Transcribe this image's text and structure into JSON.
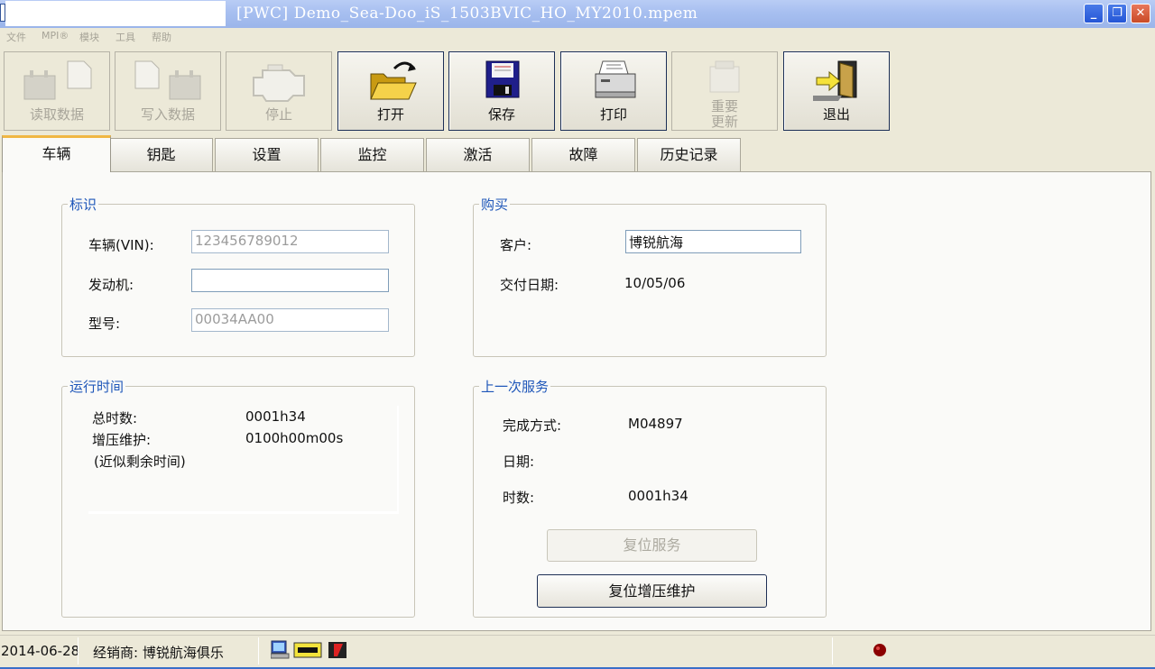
{
  "window": {
    "title": "[PWC] Demo_Sea-Doo_iS_1503BVIC_HO_MY2010.mpem",
    "minimize": "_",
    "restore": "❐",
    "close": "✕"
  },
  "menu": [
    "文件",
    "MPI®",
    "模块",
    "工具",
    "帮助"
  ],
  "toolbar": [
    {
      "label": "读取数据",
      "icon": "read-data-icon",
      "enabled": false
    },
    {
      "label": "写入数据",
      "icon": "write-data-icon",
      "enabled": false
    },
    {
      "label": "停止",
      "icon": "engine-stop-icon",
      "enabled": false
    },
    {
      "label": "打开",
      "icon": "open-folder-icon",
      "enabled": true
    },
    {
      "label": "保存",
      "icon": "floppy-disk-icon",
      "enabled": true
    },
    {
      "label": "打印",
      "icon": "printer-icon",
      "enabled": true
    },
    {
      "label_line1": "重要",
      "label_line2": "更新",
      "icon": "update-icon",
      "enabled": false
    },
    {
      "label": "退出",
      "icon": "exit-door-icon",
      "enabled": true
    }
  ],
  "tabs": [
    "车辆",
    "钥匙",
    "设置",
    "监控",
    "激活",
    "故障",
    "历史记录"
  ],
  "active_tab": "车辆",
  "identification": {
    "title": "标识",
    "vin_label": "车辆(VIN):",
    "vin_value": "123456789012",
    "engine_label": "发动机:",
    "engine_value": "",
    "model_label": "型号:",
    "model_value": "00034AA00"
  },
  "purchase": {
    "title": "购买",
    "customer_label": "客户:",
    "customer_value": "博锐航海",
    "delivery_label": "交付日期:",
    "delivery_value": "10/05/06"
  },
  "runtime": {
    "title": "运行时间",
    "total_hours_label": "总时数:",
    "total_hours_value": "0001h34",
    "supercharger_label": "增压维护:",
    "supercharger_value": "0100h00m00s",
    "approx_label": "(近似剩余时间)"
  },
  "last_service": {
    "title": "上一次服务",
    "done_by_label": "完成方式:",
    "done_by_value": "M04897",
    "date_label": "日期:",
    "date_value": "",
    "hours_label": "时数:",
    "hours_value": "0001h34",
    "reset_service_button": "复位服务",
    "reset_supercharger_button": "复位增压维护"
  },
  "status": {
    "date": "2014-06-28",
    "dealer": "经销商: 博锐航海俱乐"
  },
  "colors": {
    "group_title": "#1e56b9",
    "tab_accent": "#f0b744",
    "status_led": "#8b0000"
  }
}
